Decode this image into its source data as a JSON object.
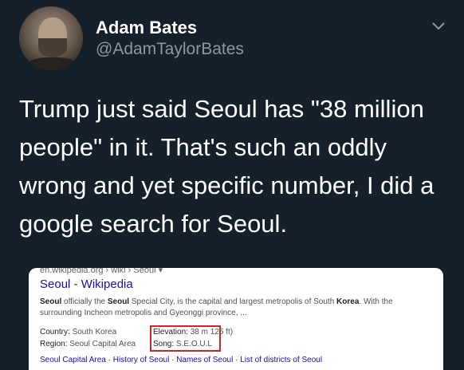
{
  "tweet": {
    "display_name": "Adam Bates",
    "handle": "@AdamTaylorBates",
    "text": "Trump just said Seoul has \"38 million people\" in it. That's such an oddly wrong and yet specific number, I did a google search for Seoul."
  },
  "card": {
    "url": "en.wikipedia.org › wiki › Seoul ▾",
    "title": "Seoul - Wikipedia",
    "snippet_pre": "",
    "snippet_b1": "Seoul",
    "snippet_mid1": " officially the ",
    "snippet_b2": "Seoul",
    "snippet_mid2": " Special City, is the capital and largest metropolis of South ",
    "snippet_b3": "Korea",
    "snippet_post": ". With the surrounding Incheon metropolis and Gyeonggi province, ...",
    "country_label": "Country:",
    "country_value": " South Korea",
    "elevation_label": "Elevation:",
    "elevation_value": " 38 m",
    "elevation_rest": " 125 ft)",
    "region_label": "Region:",
    "region_value": " Seoul Capital Area",
    "song_label": "Song:",
    "song_value": " S.E.O.U.L",
    "links": "Seoul Capital Area · History of Seoul · Names of Seoul · List of districts of Seoul"
  }
}
